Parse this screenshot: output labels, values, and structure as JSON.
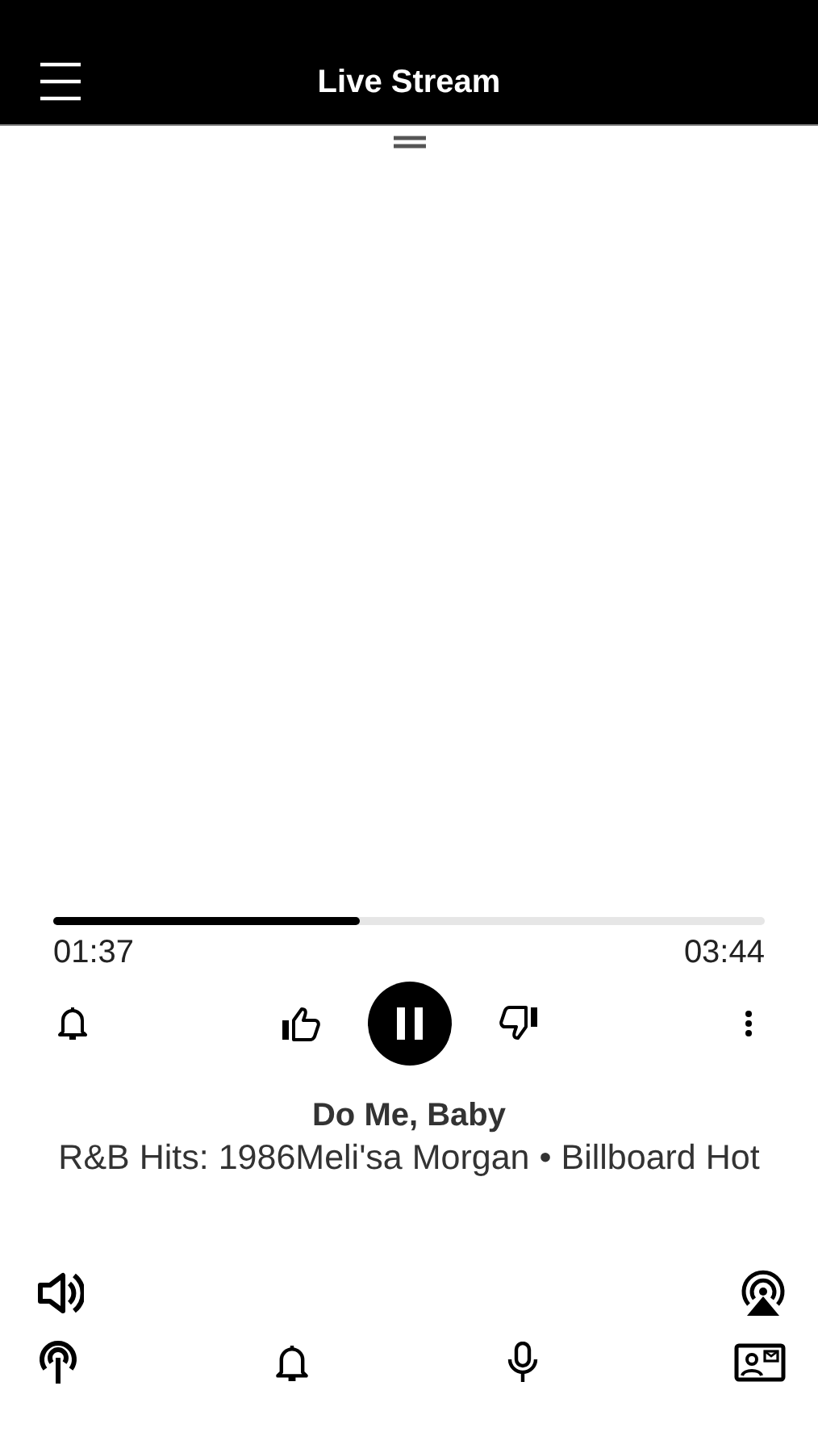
{
  "header": {
    "title": "Live Stream"
  },
  "player": {
    "level": 0.43,
    "elapsed": "01:37",
    "duration": "03:44",
    "playing": true,
    "track_title": "Do Me, Baby",
    "track_subtitle": "R&B Hits: 1986Meli'sa Morgan • Billboard Hot"
  }
}
